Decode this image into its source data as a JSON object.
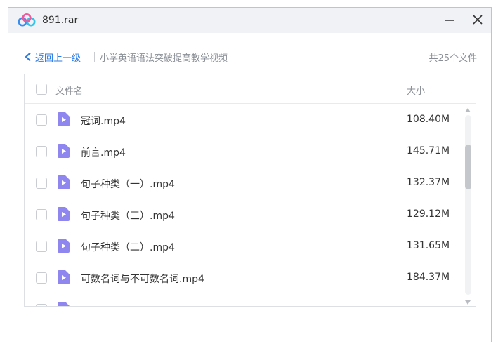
{
  "window": {
    "title": "891.rar"
  },
  "nav": {
    "back_label": "返回上一级",
    "folder_path": "小学英语语法突破提高教学视频",
    "file_count": "共25个文件"
  },
  "list": {
    "columns": {
      "name": "文件名",
      "size": "大小"
    },
    "rows": [
      {
        "name": "冠词.mp4",
        "size": "108.40M"
      },
      {
        "name": "前言.mp4",
        "size": "145.71M"
      },
      {
        "name": "句子种类（一）.mp4",
        "size": "132.37M"
      },
      {
        "name": "句子种类（三）.mp4",
        "size": "129.12M"
      },
      {
        "name": "句子种类（二）.mp4",
        "size": "131.65M"
      },
      {
        "name": "可数名词与不可数名词.mp4",
        "size": "184.37M"
      },
      {
        "name": "",
        "size": ""
      }
    ]
  },
  "icons": {
    "logo": "cloud-logo-icon",
    "file": "video-file-icon"
  },
  "colors": {
    "link": "#2c7be5",
    "file_icon": "#8f86f0",
    "logo_blue": "#3a8ef0",
    "logo_cyan": "#35c3e8",
    "logo_pink": "#f05a9a"
  }
}
